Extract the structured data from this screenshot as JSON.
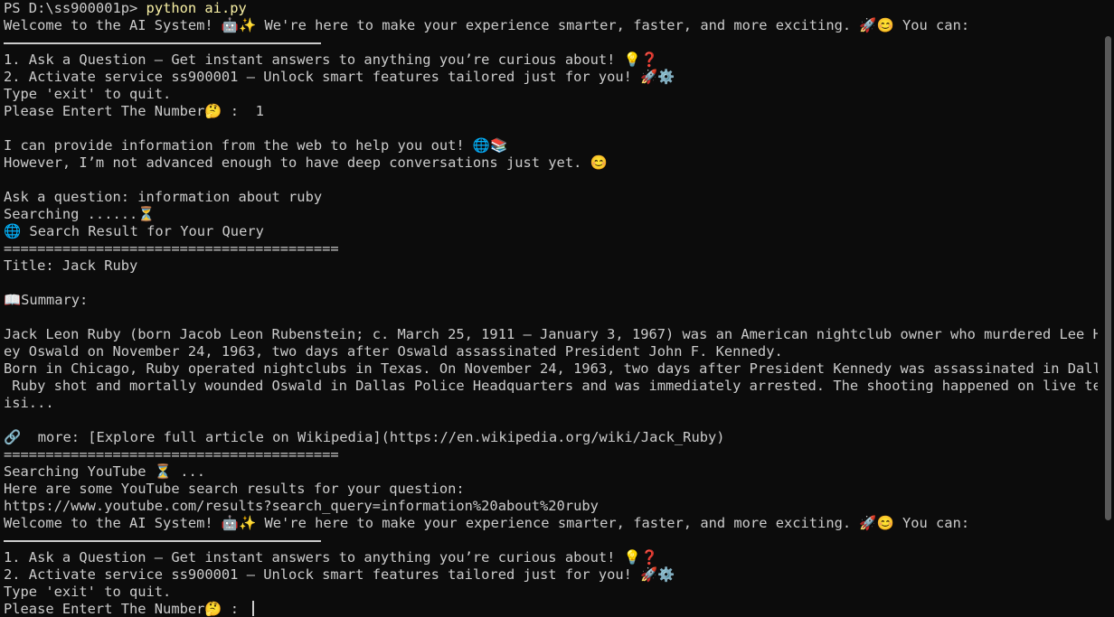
{
  "terminal": {
    "prompt": "PS D:\\ss900001p>",
    "command": "python ai.py",
    "first_menu": {
      "welcome": "Welcome to the AI System! 🤖✨ We're here to make your experience smarter, faster, and more exciting. 🚀😊 You can:",
      "option1": "1. Ask a Question – Get instant answers to anything you’re curious about! 💡❓",
      "option2": "2. Activate service ss900001 – Unlock smart features tailored just for you! 🚀⚙️",
      "exit_hint": "Type 'exit' to quit.",
      "number_prompt": "Please Entert The Number🤔 :  1"
    },
    "info_line1": "I can provide information from the web to help you out! 🌐📚",
    "info_line2": "However, I’m not advanced enough to have deep conversations just yet. 😊",
    "question": "Ask a question: information about ruby",
    "searching": "Searching ......⏳",
    "result_header": "🌐 Search Result for Your Query",
    "separator": "========================================",
    "title": "Title: Jack Ruby",
    "summary_label": "📖Summary:",
    "summary_lines": [
      "Jack Leon Ruby (born Jacob Leon Rubenstein; c. March 25, 1911 – January 3, 1967) was an American nightclub owner who murdered Lee Harv",
      "ey Oswald on November 24, 1963, two days after Oswald assassinated President John F. Kennedy.",
      "Born in Chicago, Ruby operated nightclubs in Texas. On November 24, 1963, two days after President Kennedy was assassinated in Dallas,",
      " Ruby shot and mortally wounded Oswald in Dallas Police Headquarters and was immediately arrested. The shooting happened on live telev",
      "isi..."
    ],
    "more_link": "🔗  more: [Explore full article on Wikipedia](https://en.wikipedia.org/wiki/Jack_Ruby)",
    "youtube_searching": "Searching YouTube ⏳ ...",
    "youtube_intro": "Here are some YouTube search results for your question:",
    "youtube_url": "https://www.youtube.com/results?search_query=information%20about%20ruby",
    "second_menu": {
      "welcome": "Welcome to the AI System! 🤖✨ We're here to make your experience smarter, faster, and more exciting. 🚀😊 You can:",
      "option1": "1. Ask a Question – Get instant answers to anything you’re curious about! 💡❓",
      "option2": "2. Activate service ss900001 – Unlock smart features tailored just for you! 🚀⚙️",
      "exit_hint": "Type 'exit' to quit.",
      "number_prompt": "Please Entert The Number🤔 : "
    }
  }
}
